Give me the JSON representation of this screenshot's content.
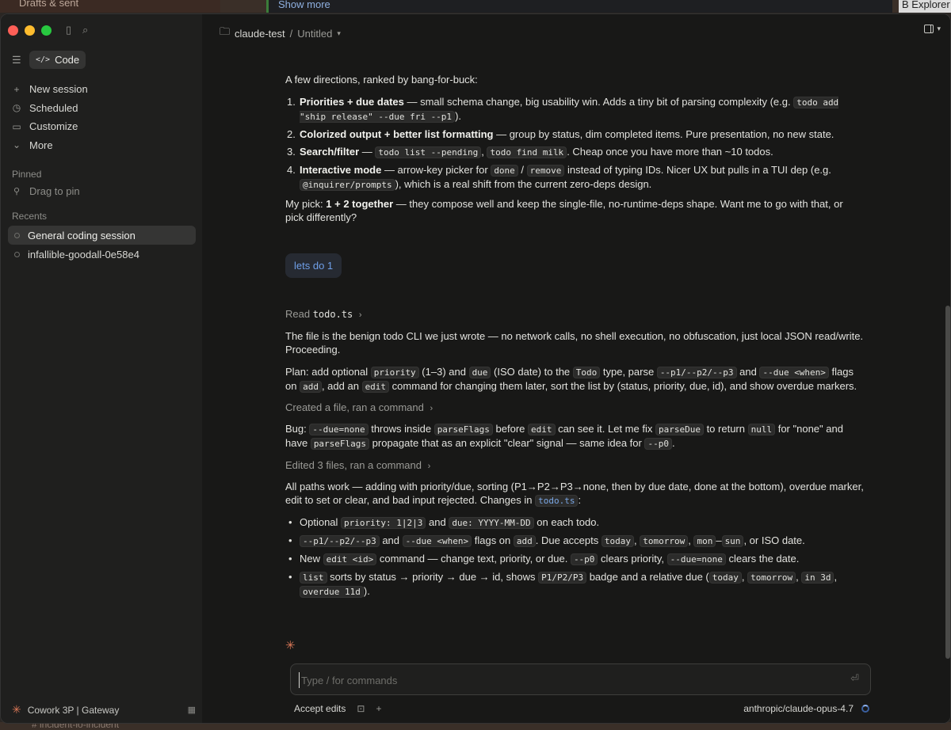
{
  "background": {
    "left_label": "Drafts & sent",
    "mid_label": "Show more",
    "right_label": "B Explorer",
    "bottom_label": "# incident-io-incident"
  },
  "sidebar": {
    "mode_label": "Code",
    "nav": [
      {
        "icon": "plus-icon",
        "glyph": "+",
        "label": "New session"
      },
      {
        "icon": "clock-icon",
        "glyph": "◷",
        "label": "Scheduled"
      },
      {
        "icon": "briefcase-icon",
        "glyph": "▭",
        "label": "Customize"
      },
      {
        "icon": "chevron-down-icon",
        "glyph": "⌄",
        "label": "More"
      }
    ],
    "pinned_label": "Pinned",
    "pin_hint": "Drag to pin",
    "recents_label": "Recents",
    "recents": [
      {
        "label": "General coding session",
        "active": true
      },
      {
        "label": "infallible-goodall-0e58e4",
        "active": false
      }
    ],
    "footer_label": "Cowork 3P | Gateway"
  },
  "header": {
    "project": "claude-test",
    "separator": "/",
    "session": "Untitled"
  },
  "messages": {
    "intro": "A few directions, ranked by bang-for-buck:",
    "directions": [
      {
        "num": "1.",
        "title": "Priorities + due dates",
        "text": " — small schema change, big usability win. Adds a tiny bit of parsing complexity (e.g. ",
        "code": "todo add \"ship release\" --due fri --p1",
        "after": ")."
      },
      {
        "num": "2.",
        "title": "Colorized output + better list formatting",
        "text": " — group by status, dim completed items. Pure presentation, no new state."
      },
      {
        "num": "3.",
        "title": "Search/filter",
        "text": " — ",
        "code1": "todo list --pending",
        "mid": ", ",
        "code2": "todo find milk",
        "after": ". Cheap once you have more than ~10 todos."
      },
      {
        "num": "4.",
        "title": "Interactive mode",
        "text": " — arrow-key picker for ",
        "code1": "done",
        "mid": " / ",
        "code2": "remove",
        "after": " instead of typing IDs. Nicer UX but pulls in a TUI dep (e.g. ",
        "code3": "@inquirer/prompts",
        "after2": "), which is a real shift from the current zero-deps design."
      }
    ],
    "pick_prefix": "My pick: ",
    "pick_bold": "1 + 2 together",
    "pick_suffix": " — they compose well and keep the single-file, no-runtime-deps shape. Want me to go with that, or pick differently?",
    "user_message": "lets do 1",
    "read_label": "Read",
    "read_file": "todo.ts",
    "benign_text": "The file is the benign todo CLI we just wrote — no network calls, no shell execution, no obfuscation, just local JSON read/write. Proceeding.",
    "plan": {
      "t1": "Plan: add optional ",
      "c1": "priority",
      "t2": " (1–3) and ",
      "c2": "due",
      "t3": " (ISO date) to the ",
      "c3": "Todo",
      "t4": " type, parse ",
      "c4": "--p1/--p2/--p3",
      "t5": " and ",
      "c5": "--due <when>",
      "t6": " flags on ",
      "c6": "add",
      "t7": ", add an ",
      "c7": "edit",
      "t8": " command for changing them later, sort the list by (status, priority, due, id), and show overdue markers."
    },
    "tool1": "Created a file, ran a command",
    "bug": {
      "t1": "Bug: ",
      "c1": "--due=none",
      "t2": " throws inside ",
      "c2": "parseFlags",
      "t3": " before ",
      "c3": "edit",
      "t4": " can see it. Let me fix ",
      "c4": "parseDue",
      "t5": " to return ",
      "c5": "null",
      "t6": " for \"none\" and have ",
      "c6": "parseFlags",
      "t7": " propagate that as an explicit \"clear\" signal — same idea for ",
      "c7": "--p0",
      "t8": "."
    },
    "tool2": "Edited 3 files, ran a command",
    "summary_text": "All paths work — adding with priority/due, sorting (P1→P2→P3→none, then by due date, done at the bottom), overdue marker, edit to set or clear, and bad input rejected. Changes in ",
    "summary_file": "todo.ts",
    "summary_end": ":",
    "changes": {
      "b1": {
        "t1": "Optional ",
        "c1": "priority: 1|2|3",
        "t2": " and ",
        "c2": "due: YYYY-MM-DD",
        "t3": " on each todo."
      },
      "b2": {
        "c1": "--p1/--p2/--p3",
        "t1": " and ",
        "c2": "--due <when>",
        "t2": " flags on ",
        "c3": "add",
        "t3": ". Due accepts ",
        "c4": "today",
        "t4": ", ",
        "c5": "tomorrow",
        "t5": ", ",
        "c6": "mon",
        "t6": "–",
        "c7": "sun",
        "t7": ", or ISO date."
      },
      "b3": {
        "t1": "New ",
        "c1": "edit <id>",
        "t2": " command — change text, priority, or due. ",
        "c2": "--p0",
        "t3": " clears priority, ",
        "c3": "--due=none",
        "t4": " clears the date."
      },
      "b4": {
        "c1": "list",
        "t1": " sorts by status → priority → due → id, shows ",
        "c2": "P1/P2/P3",
        "t2": " badge and a relative due (",
        "c3": "today",
        "t3": ", ",
        "c4": "tomorrow",
        "t4": ", ",
        "c5": "in 3d",
        "t5": ", ",
        "c6": "overdue 11d",
        "t6": ")."
      }
    }
  },
  "composer": {
    "placeholder": "Type / for commands"
  },
  "footer": {
    "accept_label": "Accept edits",
    "model": "anthropic/claude-opus-4.7"
  },
  "colors": {
    "accent_orange": "#d97757",
    "link_blue": "#6f9fe8"
  }
}
